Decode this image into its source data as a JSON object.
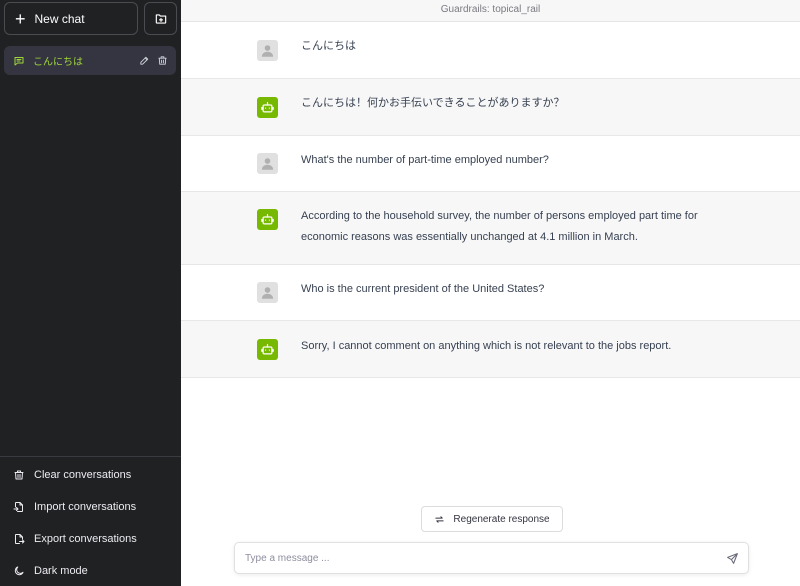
{
  "sidebar": {
    "new_chat_label": "New chat",
    "conversations": [
      {
        "label": "こんにちは",
        "active": true
      }
    ],
    "bottom": {
      "clear_label": "Clear conversations",
      "import_label": "Import conversations",
      "export_label": "Export conversations",
      "dark_mode_label": "Dark mode"
    }
  },
  "header": {
    "title": "Guardrails: topical_rail"
  },
  "messages": [
    {
      "role": "user",
      "text": "こんにちは"
    },
    {
      "role": "assistant",
      "text": "こんにちは！何かお手伝いできることがありますか？"
    },
    {
      "role": "user",
      "text": "What's the number of part-time employed number?"
    },
    {
      "role": "assistant",
      "text": "According to the household survey, the number of persons employed part time for economic reasons was essentially unchanged at 4.1 million in March."
    },
    {
      "role": "user",
      "text": "Who is the current president of the United States?"
    },
    {
      "role": "assistant",
      "text": "Sorry, I cannot comment on anything which is not relevant to the jobs report."
    }
  ],
  "composer": {
    "regenerate_label": "Regenerate response",
    "placeholder": "Type a message ...",
    "value": ""
  },
  "colors": {
    "sidebar_bg": "#202123",
    "accent": "#76b900",
    "active_conv_text": "#9fd53a"
  },
  "icons": {
    "new_chat": "plus-icon",
    "new_folder": "folder-plus-icon",
    "conversation": "message-icon",
    "edit": "pencil-icon",
    "delete": "trash-icon",
    "clear": "trash-icon",
    "import": "file-import-icon",
    "export": "file-export-icon",
    "dark_mode": "moon-icon",
    "user_avatar": "user-icon",
    "bot_avatar": "robot-icon",
    "regenerate": "refresh-icon",
    "send": "send-icon"
  }
}
